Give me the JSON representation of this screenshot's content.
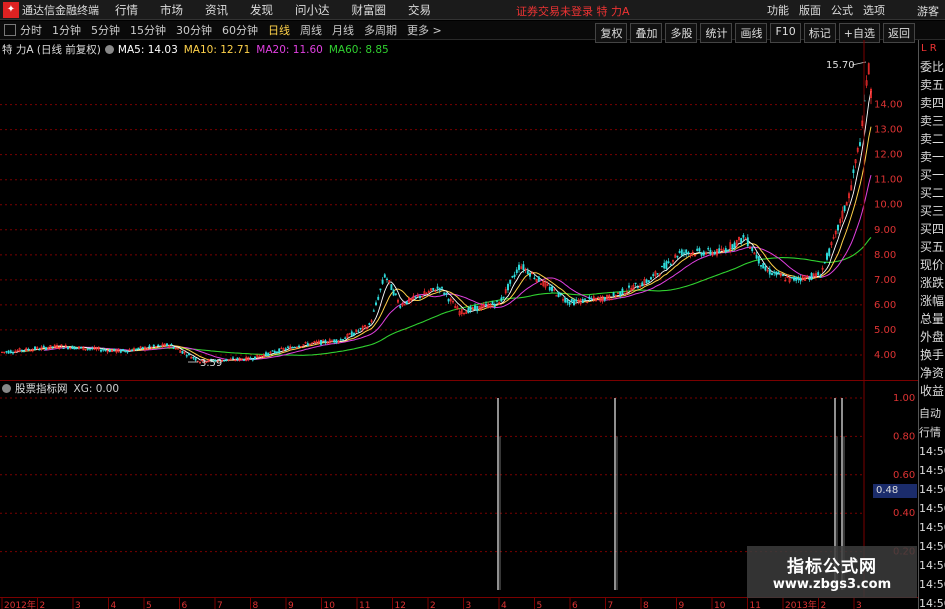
{
  "menubar": {
    "app_title": "通达信金融终端",
    "items": [
      "行情",
      "市场",
      "资讯",
      "发现",
      "问小达",
      "财富圈",
      "交易"
    ],
    "status": "证券交易未登录  特 力A",
    "right_items": [
      "功能",
      "版面",
      "公式",
      "选项"
    ],
    "guest": "游客"
  },
  "periodbar": {
    "periods": [
      "分时",
      "1分钟",
      "5分钟",
      "15分钟",
      "30分钟",
      "60分钟",
      "日线",
      "周线",
      "月线",
      "多周期",
      "更多 >"
    ],
    "active_index": 6,
    "tools": [
      "复权",
      "叠加",
      "多股",
      "统计",
      "画线",
      "F10",
      "标记",
      "+自选",
      "返回"
    ]
  },
  "ma_row": {
    "stock": "特 力A (日线 前复权)",
    "ma5": "MA5: 14.03",
    "ma10": "MA10: 12.71",
    "ma20": "MA20: 11.60",
    "ma60": "MA60: 8.85",
    "colors": {
      "ma5": "#ffffff",
      "ma10": "#ffd24a",
      "ma20": "#e040e0",
      "ma60": "#30d030"
    }
  },
  "price_axis": {
    "ticks": [
      "14.00",
      "13.00",
      "12.00",
      "11.00",
      "10.00",
      "9.00",
      "8.00",
      "7.00",
      "6.00",
      "5.00",
      "4.00"
    ],
    "high_label": "15.70",
    "low_label": "3.59"
  },
  "indicator": {
    "name": "股票指标网",
    "xg": "XG: 0.00",
    "ticks": [
      "1.00",
      "0.80",
      "0.60",
      "0.40",
      "0.20"
    ],
    "highlight": "0.48"
  },
  "sidebar": {
    "lr": "L  R",
    "items": [
      "委比",
      "卖五",
      "卖四",
      "卖三",
      "卖二",
      "卖一",
      "买一",
      "买二",
      "买三",
      "买四",
      "买五",
      "现价",
      "涨跌",
      "涨幅",
      "总量",
      "外盘",
      "换手",
      "净资",
      "收益"
    ],
    "lower_items": [
      "自动",
      "行情",
      "14:50",
      "14:50",
      "14:50",
      "14:50",
      "14:50",
      "14:50",
      "14:50",
      "14:50",
      "14:50"
    ]
  },
  "time_axis": {
    "labels": [
      "2012年",
      "2",
      "3",
      "4",
      "5",
      "6",
      "7",
      "8",
      "9",
      "10",
      "11",
      "12",
      "2",
      "3",
      "4",
      "5",
      "6",
      "7",
      "8",
      "9",
      "10",
      "11",
      "2013年",
      "2",
      "3"
    ]
  },
  "watermark": {
    "line1": "指标公式网",
    "line2": "www.zbgs3.com"
  }
}
